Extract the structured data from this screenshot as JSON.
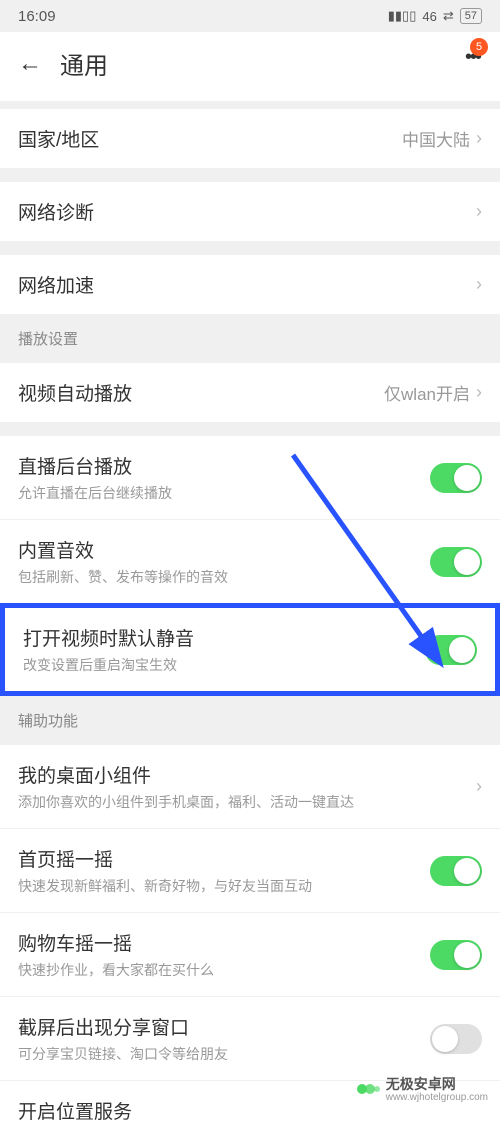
{
  "status": {
    "time": "16:09",
    "network_label": "46",
    "battery": "57"
  },
  "header": {
    "title": "通用",
    "badge": "5"
  },
  "sections": {
    "general": {
      "region": {
        "label": "国家/地区",
        "value": "中国大陆"
      },
      "netdiag": {
        "label": "网络诊断"
      },
      "netboost": {
        "label": "网络加速"
      }
    },
    "playback": {
      "title": "播放设置",
      "autoplay": {
        "label": "视频自动播放",
        "value": "仅wlan开启"
      },
      "bgplay": {
        "label": "直播后台播放",
        "sub": "允许直播在后台继续播放"
      },
      "sound": {
        "label": "内置音效",
        "sub": "包括刷新、赞、发布等操作的音效"
      },
      "mute": {
        "label": "打开视频时默认静音",
        "sub": "改变设置后重启淘宝生效"
      }
    },
    "assist": {
      "title": "辅助功能",
      "widget": {
        "label": "我的桌面小组件",
        "sub": "添加你喜欢的小组件到手机桌面，福利、活动一键直达"
      },
      "shake_home": {
        "label": "首页摇一摇",
        "sub": "快速发现新鲜福利、新奇好物，与好友当面互动"
      },
      "shake_cart": {
        "label": "购物车摇一摇",
        "sub": "快速抄作业，看大家都在买什么"
      },
      "screenshot": {
        "label": "截屏后出现分享窗口",
        "sub": "可分享宝贝链接、淘口令等给朋友"
      },
      "location": {
        "label": "开启位置服务"
      }
    }
  },
  "watermark": {
    "brand": "无极安卓网",
    "url": "www.wjhotelgroup.com"
  }
}
